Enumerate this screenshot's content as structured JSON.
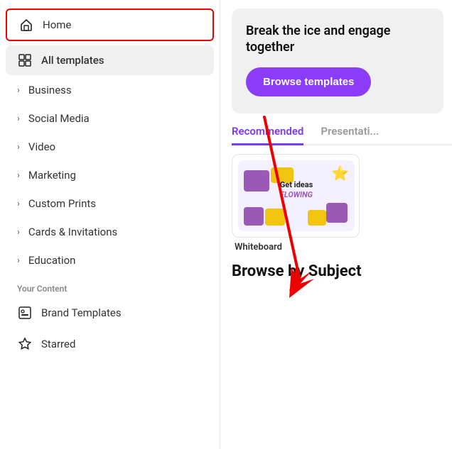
{
  "sidebar": {
    "home_label": "Home",
    "all_templates_label": "All templates",
    "items": [
      {
        "label": "Business",
        "id": "business"
      },
      {
        "label": "Social Media",
        "id": "social-media"
      },
      {
        "label": "Video",
        "id": "video"
      },
      {
        "label": "Marketing",
        "id": "marketing"
      },
      {
        "label": "Custom Prints",
        "id": "custom-prints"
      },
      {
        "label": "Cards & Invitations",
        "id": "cards-invitations"
      },
      {
        "label": "Education",
        "id": "education"
      }
    ],
    "your_content_label": "Your Content",
    "your_content_items": [
      {
        "label": "Brand Templates",
        "id": "brand-templates"
      },
      {
        "label": "Starred",
        "id": "starred"
      }
    ]
  },
  "main": {
    "hero": {
      "text": "Break the ice and engage together",
      "browse_btn": "Browse templates"
    },
    "tabs": [
      {
        "label": "Recommended",
        "active": true
      },
      {
        "label": "Presentati...",
        "active": false
      }
    ],
    "template_card": {
      "title": "Whiteboard",
      "preview_text_line1": "Get ideas",
      "preview_text_line2": "FLOWING"
    },
    "browse_subject_title": "Browse by Subject"
  }
}
